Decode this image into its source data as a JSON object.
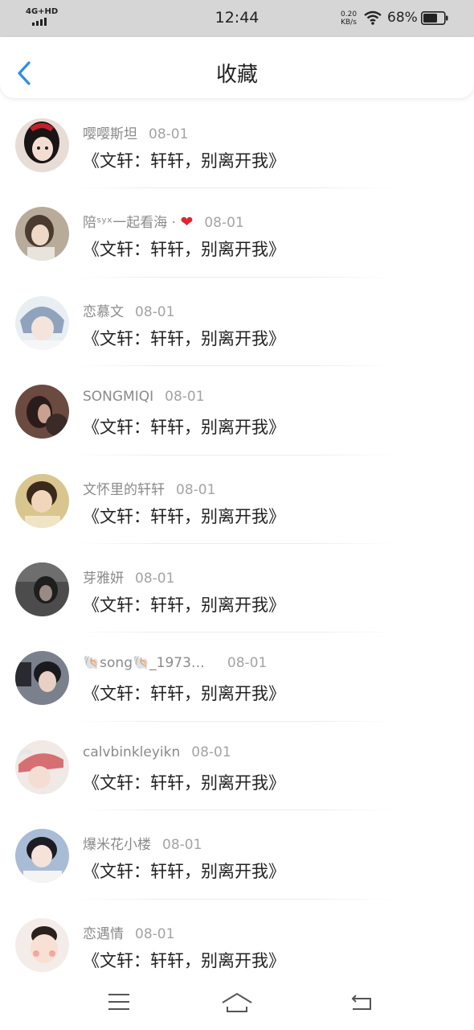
{
  "status_bar": {
    "network": "4G+HD",
    "time": "12:44",
    "speed_value": "0.20",
    "speed_unit": "KB/s",
    "battery": "68%"
  },
  "header": {
    "title": "收藏"
  },
  "items": [
    {
      "user": "嘤嘤斯坦",
      "date": "08-01",
      "text": "《文轩：轩轩，别离开我》",
      "avatar_color": "#3b2a2a"
    },
    {
      "user": "陪ˢʸˣ一起看海 · ",
      "heart": "❤",
      "date": "08-01",
      "text": "《文轩：轩轩，别离开我》",
      "avatar_color": "#8c7b6a"
    },
    {
      "user": "恋慕文",
      "date": "08-01",
      "text": "《文轩：轩轩，别离开我》",
      "avatar_color": "#9aa7b8"
    },
    {
      "user": "SONGMIQI",
      "date": "08-01",
      "text": "《文轩：轩轩，别离开我》",
      "avatar_color": "#4a3530"
    },
    {
      "user": "文怀里的轩轩",
      "date": "08-01",
      "text": "《文轩：轩轩，别离开我》",
      "avatar_color": "#c9a86a"
    },
    {
      "user": "芽雅妍",
      "date": "08-01",
      "text": "《文轩：轩轩，别离开我》",
      "avatar_color": "#3a3a3a"
    },
    {
      "user": "🐚song🐚_1973…",
      "date": "08-01",
      "text": "《文轩：轩轩，别离开我》",
      "avatar_color": "#5a5f6a"
    },
    {
      "user": "calvbinkleyikn",
      "date": "08-01",
      "text": "《文轩：轩轩，别离开我》",
      "avatar_color": "#d98a8a"
    },
    {
      "user": "爆米花小楼",
      "date": "08-01",
      "text": "《文轩：轩轩，别离开我》",
      "avatar_color": "#8aa4c8"
    },
    {
      "user": "恋遇情",
      "date": "08-01",
      "text": "《文轩：轩轩，别离开我》",
      "avatar_color": "#e8b8a8"
    }
  ],
  "colors": {
    "accent": "#2a8ee6",
    "heart": "#e0262b"
  }
}
